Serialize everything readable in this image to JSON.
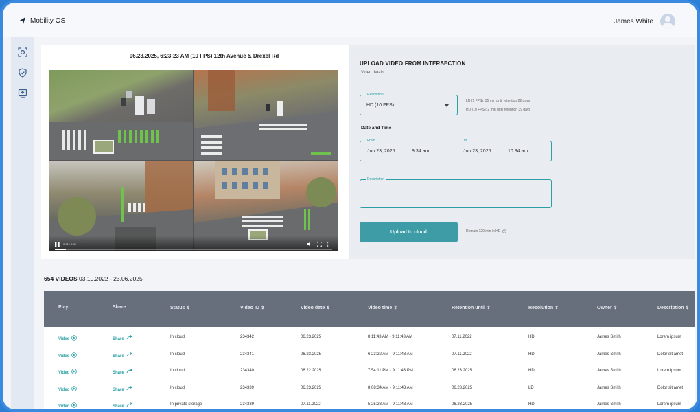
{
  "app": {
    "name": "Mobility OS"
  },
  "user": {
    "name": "James White"
  },
  "sidebar": {
    "items": [
      {
        "icon": "camera-scan-icon"
      },
      {
        "icon": "shield-check-icon"
      },
      {
        "icon": "upload-icon"
      }
    ]
  },
  "video": {
    "title": "06.23.2025, 6:23:23 AM (10 FPS) 12th Avenue & Drexel Rd",
    "timestamp": "0:01 / 0:30"
  },
  "upload": {
    "title": "UPLOAD VIDEO FROM INTERSECTION",
    "subtitle": "Video details",
    "resolution": {
      "label": "Resolution",
      "value": "HD (10 FPS)"
    },
    "resolution_notes": [
      "LD (1 FPS): 35 min until retention 22 days",
      "HD (10 FPS): 2 min until retention 39 days"
    ],
    "date_time_label": "Date and Time",
    "from": {
      "label": "From",
      "date": "Jun 23, 2025",
      "time": "9.34 am"
    },
    "to": {
      "label": "To",
      "date": "Jun 23, 2025",
      "time": "10.34 am"
    },
    "description": {
      "label": "Description",
      "value": ""
    },
    "button": "Upload to cloud",
    "remain": "Remain 120 min in HD"
  },
  "list": {
    "count": "654 VIDEOS",
    "range": "03.10.2022 - 23.06.2025",
    "columns": [
      "Play",
      "Share",
      "Status",
      "Video ID",
      "Video date",
      "Video time",
      "Retention until",
      "Resolution",
      "Owner",
      "Description"
    ],
    "rows": [
      {
        "play": "Video",
        "share": "Share",
        "status": "In cloud",
        "id": "234342",
        "date": "06.23.2025",
        "time": "8:11:43 AM - 9:11:43 AM",
        "retention": "07.11.2022",
        "resolution": "HD",
        "owner": "James Smith",
        "description": "Lorem ipsum"
      },
      {
        "play": "Video",
        "share": "Share",
        "status": "In cloud",
        "id": "234341",
        "date": "06.23.2025",
        "time": "6:23:22 AM - 9:11:43 AM",
        "retention": "07.11.2022",
        "resolution": "HD",
        "owner": "James Smith",
        "description": "Dolor sit amet"
      },
      {
        "play": "Video",
        "share": "Share",
        "status": "In cloud",
        "id": "234340",
        "date": "06.22.2025",
        "time": "7:54:11 PM - 9:11:43 PM",
        "retention": "06.23.2025",
        "resolution": "HD",
        "owner": "James Smith",
        "description": "Lorem ipsum"
      },
      {
        "play": "Video",
        "share": "Share",
        "status": "In cloud",
        "id": "234339",
        "date": "06.23.2025",
        "time": "8:08:34 AM - 9:11:43 AM",
        "retention": "06.23.2025",
        "resolution": "LD",
        "owner": "James Smith",
        "description": "Dolor sit amet"
      },
      {
        "play": "Video",
        "share": "Share",
        "status": "In private storage",
        "id": "234339",
        "date": "07.11.2022",
        "time": "5:25:23 AM - 9:11:43 AM",
        "retention": "06.23.2025",
        "resolution": "HD",
        "owner": "James Smith",
        "description": "Lorem ipsum"
      }
    ]
  },
  "colors": {
    "accent": "#2aa0a4",
    "button": "#3e9ca6",
    "table_header": "#676f7c",
    "frame": "#3a8ae0"
  }
}
